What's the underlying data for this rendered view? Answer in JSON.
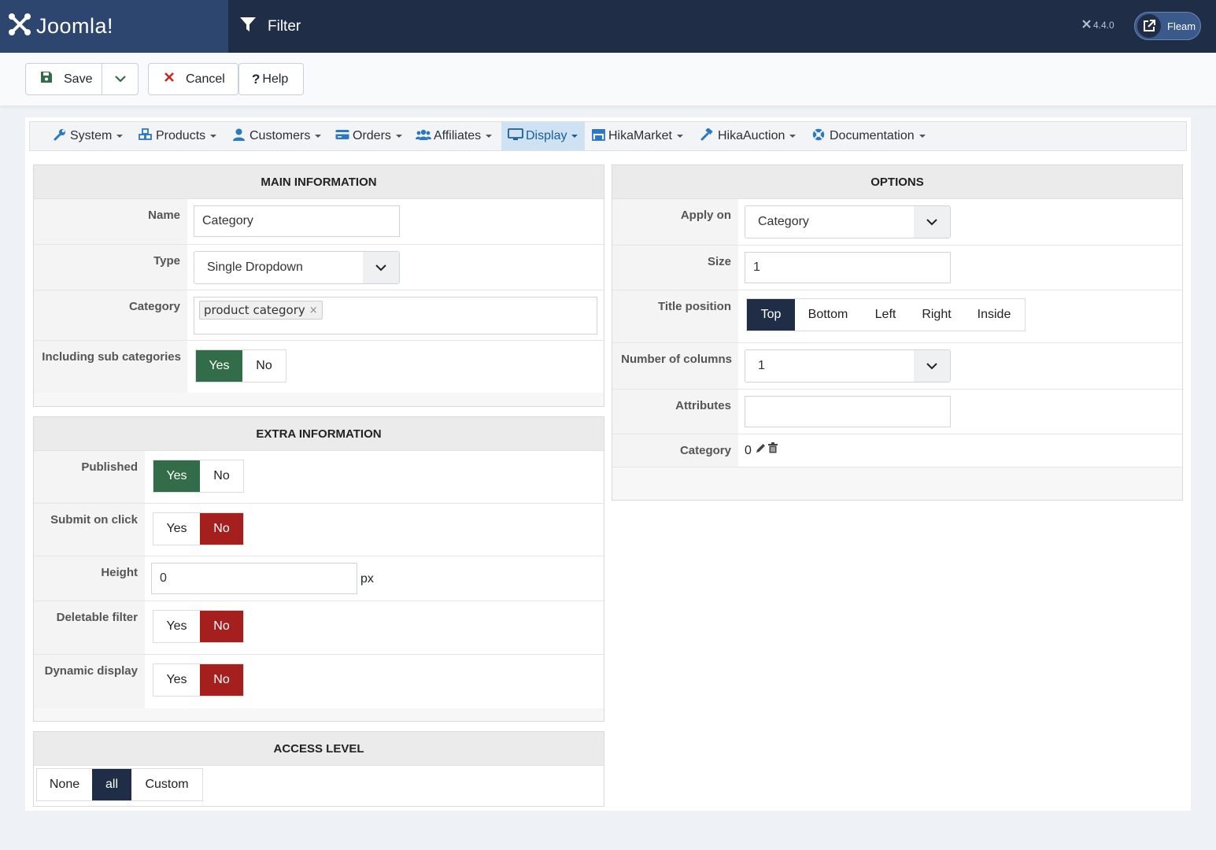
{
  "header": {
    "brand": "Joomla!",
    "page_title": "Filter",
    "version": "4.4.0",
    "user_label": "Fleam"
  },
  "toolbar": {
    "save_label": "Save",
    "cancel_label": "Cancel",
    "help_label": "Help"
  },
  "menu": [
    {
      "label": "System"
    },
    {
      "label": "Products"
    },
    {
      "label": "Customers"
    },
    {
      "label": "Orders"
    },
    {
      "label": "Affiliates"
    },
    {
      "label": "Display",
      "active": true
    },
    {
      "label": "HikaMarket"
    },
    {
      "label": "HikaAuction"
    },
    {
      "label": "Documentation"
    }
  ],
  "main_information": {
    "title": "MAIN INFORMATION",
    "name_label": "Name",
    "name_value": "Category",
    "type_label": "Type",
    "type_value": "Single Dropdown",
    "category_label": "Category",
    "category_tag": "product category",
    "category_tag_remove": "×",
    "sub_label": "Including sub categories",
    "sub_yes": "Yes",
    "sub_no": "No",
    "sub_selected": "Yes"
  },
  "extra_information": {
    "title": "EXTRA INFORMATION",
    "published_label": "Published",
    "published_selected": "Yes",
    "submit_label": "Submit on click",
    "submit_selected": "No",
    "height_label": "Height",
    "height_value": "0",
    "height_unit": "px",
    "deletable_label": "Deletable filter",
    "deletable_selected": "No",
    "dynamic_label": "Dynamic display",
    "dynamic_selected": "No",
    "yes": "Yes",
    "no": "No"
  },
  "access_level": {
    "title": "ACCESS LEVEL",
    "options": [
      "None",
      "all",
      "Custom"
    ],
    "selected": "all"
  },
  "options": {
    "title": "OPTIONS",
    "apply_on_label": "Apply on",
    "apply_on_value": "Category",
    "size_label": "Size",
    "size_value": "1",
    "title_position_label": "Title position",
    "title_positions": [
      "Top",
      "Bottom",
      "Left",
      "Right",
      "Inside"
    ],
    "title_position_selected": "Top",
    "columns_label": "Number of columns",
    "columns_value": "1",
    "attributes_label": "Attributes",
    "attributes_value": "",
    "category_label": "Category",
    "category_value": "0"
  },
  "colors": {
    "header_bg": "#1f2d47",
    "brand_bg": "#2c4670",
    "yes_green": "#336c48",
    "no_red": "#a51f1f",
    "selected_dark": "#1f2d47",
    "menu_active_bg": "#cfe2f3"
  }
}
